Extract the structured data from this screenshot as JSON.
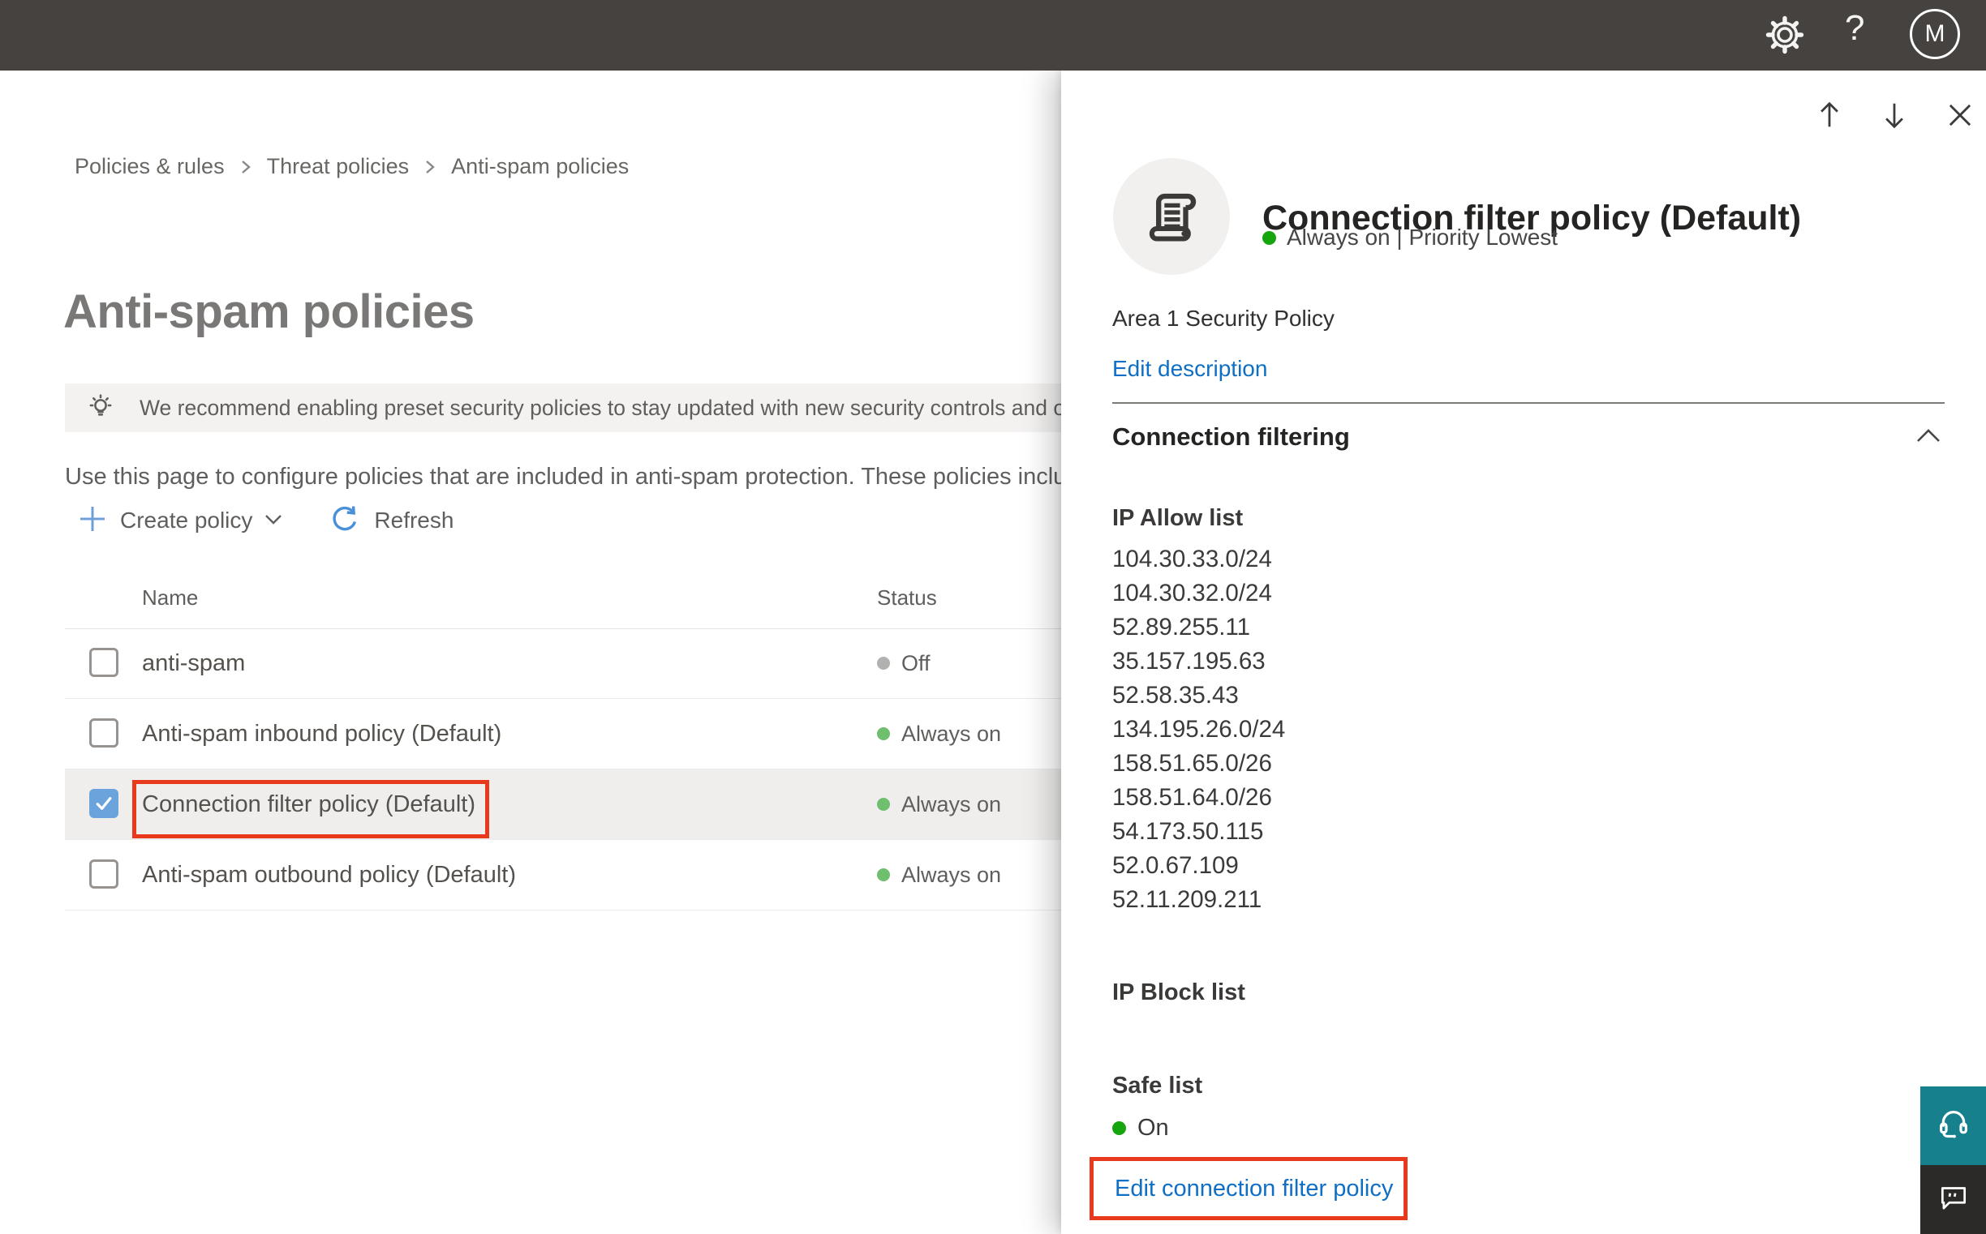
{
  "topbar": {
    "avatar_initial": "M"
  },
  "breadcrumb": {
    "items": [
      "Policies & rules",
      "Threat policies",
      "Anti-spam policies"
    ]
  },
  "page": {
    "title": "Anti-spam policies",
    "banner_text": "We recommend enabling preset security policies to stay updated with new security controls and our recomme",
    "description": "Use this page to configure policies that are included in anti-spam protection. These policies include"
  },
  "toolbar": {
    "create_policy_label": "Create policy",
    "refresh_label": "Refresh"
  },
  "table": {
    "columns": {
      "name": "Name",
      "status": "Status"
    },
    "rows": [
      {
        "name": "anti-spam",
        "status": "Off",
        "status_color": "#b3b1af",
        "checked": false,
        "selected": false
      },
      {
        "name": "Anti-spam inbound policy (Default)",
        "status": "Always on",
        "status_color": "#6fbf6e",
        "checked": false,
        "selected": false
      },
      {
        "name": "Connection filter policy (Default)",
        "status": "Always on",
        "status_color": "#6fbf6e",
        "checked": true,
        "selected": true,
        "annotated": true
      },
      {
        "name": "Anti-spam outbound policy (Default)",
        "status": "Always on",
        "status_color": "#6fbf6e",
        "checked": false,
        "selected": false
      }
    ]
  },
  "panel": {
    "title": "Connection filter policy (Default)",
    "status_text": "Always on | Priority Lowest",
    "status_color": "#16a50f",
    "description": "Area 1 Security Policy",
    "edit_description_label": "Edit description",
    "section_title": "Connection filtering",
    "ip_allow_label": "IP Allow list",
    "ip_allow_entries": [
      "104.30.33.0/24",
      "104.30.32.0/24",
      "52.89.255.11",
      "35.157.195.63",
      "52.58.35.43",
      "134.195.26.0/24",
      "158.51.65.0/26",
      "158.51.64.0/26",
      "54.173.50.115",
      "52.0.67.109",
      "52.11.209.211"
    ],
    "ip_block_label": "IP Block list",
    "safe_list_label": "Safe list",
    "safe_list_status": "On",
    "safe_status_color": "#16a50f",
    "edit_link_label": "Edit connection filter policy"
  },
  "colors": {
    "topbar": "#454240",
    "accent_link": "#0f6fc4",
    "annotation_red": "#e8391d",
    "checkbox_checked": "#6ba3dc",
    "status_on_soft": "#6fbf6e",
    "status_on_bright": "#16a50f",
    "status_off": "#b3b1af",
    "feedback_teal": "#16808d",
    "feedback_dark": "#2b2a28"
  }
}
